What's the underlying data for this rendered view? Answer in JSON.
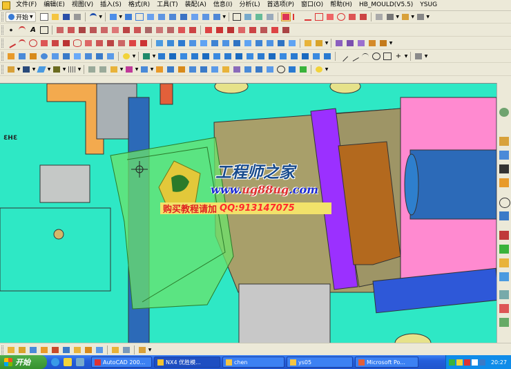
{
  "menu": {
    "items": [
      "文件(F)",
      "编辑(E)",
      "视图(V)",
      "插入(S)",
      "格式(R)",
      "工具(T)",
      "装配(A)",
      "信息(I)",
      "分析(L)",
      "首选项(P)",
      "窗口(O)",
      "帮助(H)",
      "HB_MOULD(V5.5)",
      "YSUG"
    ]
  },
  "toolbar": {
    "start_label": "开始"
  },
  "watermark": {
    "title": "工程师之家",
    "url_prefix": "www.",
    "url_mid": "ug88ug",
    "url_suffix": ".com",
    "banner_text": "购买教程请加",
    "qq": "QQ:913147075"
  },
  "viewport": {
    "model_label": "3H3"
  },
  "taskbar": {
    "start_label": "开始",
    "tasks": [
      "AutoCAD 200...",
      "NX4 优胜模...",
      "chen",
      "ys05",
      "Microsoft Po..."
    ],
    "clock": "20:27"
  },
  "colors": {
    "viewport_bg": "#2ee8c5",
    "plate_tan": "#a89f6a",
    "purple_plate": "#9b30ff",
    "pink_plate": "#ff8ad0",
    "brown_block": "#b3691e",
    "rod_blue": "#2c6ab8",
    "orange_part": "#f3aa4e",
    "selection_green": "#6be36b",
    "taskbar_blue": "#245edb"
  }
}
